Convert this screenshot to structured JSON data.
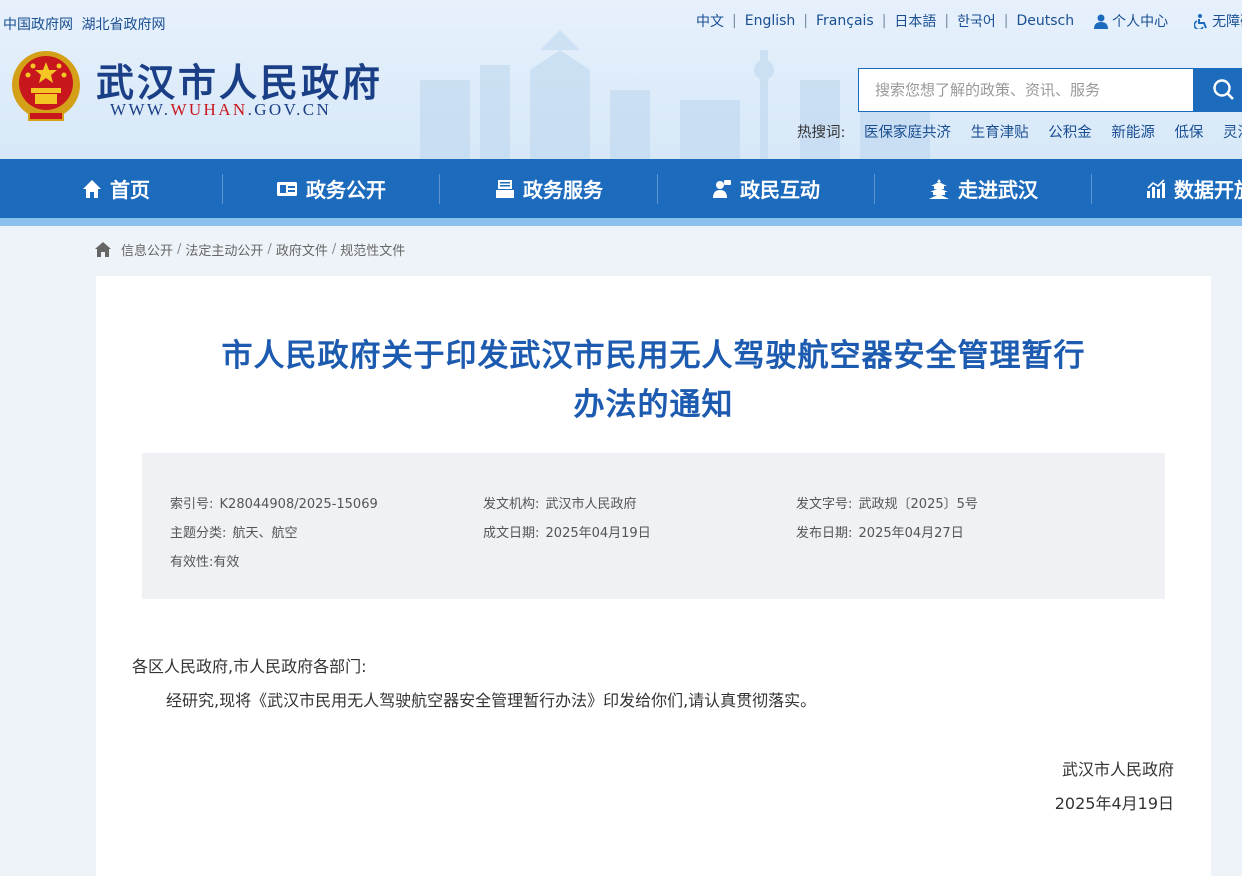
{
  "header": {
    "top_links": [
      "中国政府网",
      "湖北省政府网"
    ],
    "languages": [
      "中文",
      "English",
      "Français",
      "日本語",
      "한국어",
      "Deutsch"
    ],
    "personal_center": "个人中心",
    "accessibility": "无障碍",
    "site_name": "武汉市人民政府",
    "site_url_prefix": "WWW.",
    "site_url_brand": "WUHAN",
    "site_url_suffix": ".GOV.CN",
    "search_placeholder": "搜索您想了解的政策、资讯、服务",
    "hot_label": "热搜词:",
    "hot_words": [
      "医保家庭共济",
      "生育津贴",
      "公积金",
      "新能源",
      "低保",
      "灵活就业"
    ]
  },
  "nav": {
    "items": [
      "首页",
      "政务公开",
      "政务服务",
      "政民互动",
      "走进武汉",
      "数据开放"
    ]
  },
  "breadcrumb": [
    "信息公开",
    "法定主动公开",
    "政府文件",
    "规范性文件"
  ],
  "article": {
    "title_line1": "市人民政府关于印发武汉市民用无人驾驶航空器安全管理暂行",
    "title_line2": "办法的通知",
    "meta": {
      "index_no_label": "索引号:",
      "index_no": "K28044908/2025-15069",
      "issuer_label": "发文机构:",
      "issuer": "武汉市人民政府",
      "doc_no_label": "发文字号:",
      "doc_no": "武政规〔2025〕5号",
      "category_label": "主题分类:",
      "category": "航天、航空",
      "written_date_label": "成文日期:",
      "written_date": "2025年04月19日",
      "publish_date_label": "发布日期:",
      "publish_date": "2025年04月27日",
      "validity_label": "有效性:",
      "validity": "有效"
    },
    "salutation": "各区人民政府,市人民政府各部门:",
    "paragraph": "经研究,现将《武汉市民用无人驾驶航空器安全管理暂行办法》印发给你们,请认真贯彻落实。",
    "signature": "武汉市人民政府",
    "sign_date": "2025年4月19日"
  }
}
